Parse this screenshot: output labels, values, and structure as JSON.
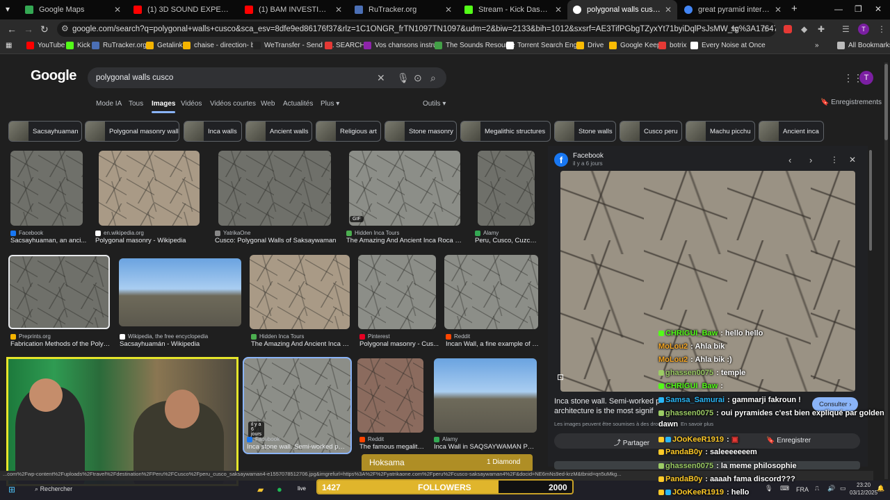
{
  "browser": {
    "tabs": [
      {
        "title": "Google Maps",
        "color": "#34a853",
        "active": false
      },
      {
        "title": "(1) 3D SOUND EXPERIENCE IN",
        "color": "#ff0000",
        "active": false
      },
      {
        "title": "(1) BAM INVESTIGATIONS - JAV",
        "color": "#ff0000",
        "active": false
      },
      {
        "title": "RuTracker.org",
        "color": "#4b6fb5",
        "active": false
      },
      {
        "title": "Stream - Kick Dashboard",
        "color": "#53fc18",
        "active": false
      },
      {
        "title": "polygonal walls cusco - Recher",
        "color": "#ffffff",
        "active": true
      },
      {
        "title": "great pyramid interior king cha",
        "color": "#4285f4",
        "active": false
      }
    ],
    "new_tab": "+",
    "url": "google.com/search?q=polygonal+walls+cusco&sca_esv=8dfe9ed86176f37&rlz=1C1ONGR_frTN1097TN1097&udm=2&biw=2133&bih=1012&sxsrf=AE3TifPGbgTZyxYt71byiDqlPsJsMW_Ig%3A1764797267265&ei=U6swaZr1...",
    "avatar_letter": "T",
    "bookmarks": [
      {
        "label": "YouTube",
        "color": "#ff0000"
      },
      {
        "label": "Kick",
        "color": "#53fc18"
      },
      {
        "label": "RuTracker.org",
        "color": "#4b6fb5"
      },
      {
        "label": "Getalink",
        "color": "#f4b400"
      },
      {
        "label": "chaise - direction- b...",
        "color": "#f4b400"
      },
      {
        "label": "WeTransfer - Send L...",
        "color": "#222222"
      },
      {
        "label": "SEARCH",
        "color": "#e53935"
      },
      {
        "label": "Vos chansons instru...",
        "color": "#8e24aa"
      },
      {
        "label": "The Sounds Resource",
        "color": "#43a047"
      },
      {
        "label": "Torrent Search Engi...",
        "color": "#ffffff"
      },
      {
        "label": "Drive",
        "color": "#fbbc04"
      },
      {
        "label": "Google Keep",
        "color": "#fbbc04"
      },
      {
        "label": "botrix",
        "color": "#e53935"
      },
      {
        "label": "Every Noise at Once",
        "color": "#ffffff"
      }
    ],
    "all_bookmarks": "All Bookmarks"
  },
  "google": {
    "logo": "Google",
    "query": "polygonal walls cusco",
    "nav_tabs": [
      "Mode IA",
      "Tous",
      "Images",
      "Vidéos",
      "Vidéos courtes",
      "Web",
      "Actualités",
      "Plus"
    ],
    "active_tab": "Images",
    "tools": "Outils",
    "saved": "Enregistrements",
    "chips": [
      "Sacsayhuaman",
      "Polygonal masonry wall",
      "Inca walls",
      "Ancient walls",
      "Religious art",
      "Stone masonry",
      "Megalithic structures",
      "Stone walls",
      "Cusco peru",
      "Machu picchu",
      "Ancient inca"
    ],
    "results": [
      {
        "source": "Facebook",
        "caption": "Sacsayhuaman, an anci...",
        "src_color": "#1877f2"
      },
      {
        "source": "en.wikipedia.org",
        "caption": "Polygonal masonry - Wikipedia",
        "src_color": "#ffffff"
      },
      {
        "source": "YatrikaOne",
        "caption": "Cusco: Polygonal Walls of Saksaywaman",
        "src_color": "#888888"
      },
      {
        "source": "Hidden Inca Tours",
        "caption": "The Amazing And Ancient Inca Roca Poly...",
        "src_color": "#4caf50",
        "badge": "GIF"
      },
      {
        "source": "Alamy",
        "caption": "Peru, Cusco, Cuzco,...",
        "src_color": "#34a853"
      },
      {
        "source": "Preprints.org",
        "caption": "Fabrication Methods of the Polygo...",
        "src_color": "#f4b400"
      },
      {
        "source": "Wikipedia, the free encyclopedia",
        "caption": "Sacsayhuamán - Wikipedia",
        "src_color": "#ffffff"
      },
      {
        "source": "Hidden Inca Tours",
        "caption": "The Amazing And Ancient Inca R...",
        "src_color": "#4caf50"
      },
      {
        "source": "Pinterest",
        "caption": "Polygonal masonry - Cus...",
        "src_color": "#e60023"
      },
      {
        "source": "Reddit",
        "caption": "Incan Wall, a fine example of m...",
        "src_color": "#ff4500"
      },
      {
        "source": "Facebook",
        "caption": "Inca stone wall. Semi-worked polig...",
        "src_color": "#1877f2",
        "badge": "il y a 6 jours"
      },
      {
        "source": "Reddit",
        "caption": "The famous megalith...",
        "src_color": "#ff4500"
      },
      {
        "source": "Alamy",
        "caption": "Inca Wall in SAQSAYWAMAN Peru ...",
        "src_color": "#34a853"
      }
    ],
    "preview": {
      "source": "Facebook",
      "age": "il y a 6 jours",
      "description": "Inca stone wall. Semi-worked p",
      "description_tail": "architecture is the most signif",
      "consult": "Consulter",
      "rights": "Les images peuvent être soumises à des droits",
      "rights_more": "En savoir plus",
      "share": "Partager",
      "save": "Enregistrer"
    },
    "status_url": "...com%2Fwp-content%2Fuploads%2Ftravel%2Fdestination%2FPeru%2FCusco%2Fperu_cusco_saksaywaman4-e1557078512706.jpg&imgrefurl=https%3A%2F%2Fyatrikaone.com%2Fperu%2Fcusco-saksaywaman4%2F&docid=NE6mNs9ed-krzM&tbnid=qn5uMkg..."
  },
  "chat": [
    {
      "user": "CHRIGUI_Baw",
      "msg": "hello hello",
      "color": "#53fc18"
    },
    {
      "user": "MoLou2",
      "msg": "Ahla bik",
      "color": "#f5a623"
    },
    {
      "user": "MoLou2",
      "msg": "Ahla bik :)",
      "color": "#f5a623"
    },
    {
      "user": "ghassen0075",
      "msg": "temple",
      "color": "#9ccc65"
    },
    {
      "user": "CHRIGUI_Baw",
      "msg": "",
      "color": "#53fc18"
    },
    {
      "user": "Samsa_Samurai",
      "msg": "gammarji fakroun !",
      "color": "#29b6f6"
    },
    {
      "user": "ghassen0075",
      "msg": "oui pyramides c'est bien expliqué par golden",
      "color": "#9ccc65"
    },
    {
      "user": "",
      "msg": "dawn",
      "color": "#ffffff"
    },
    {
      "user": "JOoKeeR1919",
      "msg": "",
      "color": "#ffca28"
    },
    {
      "user": "PandaB0y",
      "msg": "saleeeeeeem",
      "color": "#ffca28"
    },
    {
      "user": "ghassen0075",
      "msg": "la meme philosophie",
      "color": "#9ccc65"
    },
    {
      "user": "PandaB0y",
      "msg": "aaaah fama discord???",
      "color": "#ffca28"
    },
    {
      "user": "JOoKeeR1919",
      "msg": "hello",
      "color": "#ffca28"
    }
  ],
  "overlay": {
    "donation_name": "Hoksama",
    "donation_amount": "1 Diamond",
    "followers_current": "1427",
    "followers_label": "FOLLOWERS",
    "followers_goal": "2000",
    "followers_fraction": 0.71
  },
  "taskbar": {
    "search": "Rechercher",
    "lang": "FRA",
    "time": "23:20",
    "date": "03/12/2025"
  }
}
